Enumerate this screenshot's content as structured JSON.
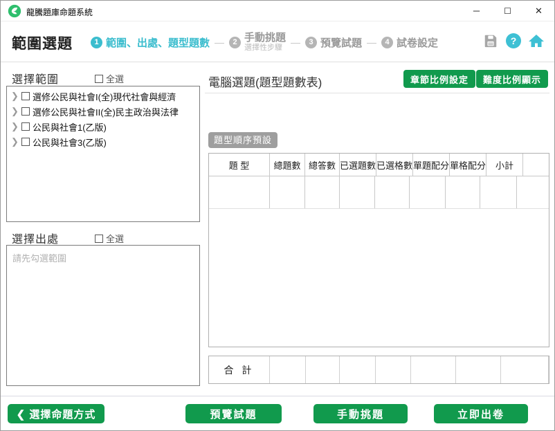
{
  "window": {
    "app_title": "龍騰題庫命題系統",
    "minimize_glyph": "─",
    "maximize_glyph": "☐",
    "close_glyph": "✕"
  },
  "header": {
    "page_title": "範圍選題",
    "step_separator": "—",
    "help_glyph": "?",
    "steps": [
      {
        "num": "1",
        "label": "範圍、出處、題型題數",
        "sublabel": ""
      },
      {
        "num": "2",
        "label": "手動挑題",
        "sublabel": "選擇性步驟"
      },
      {
        "num": "3",
        "label": "預覽試題",
        "sublabel": ""
      },
      {
        "num": "4",
        "label": "試卷設定",
        "sublabel": ""
      }
    ]
  },
  "left": {
    "range_title": "選擇範圍",
    "range_select_all": "全選",
    "tree_items": [
      "選修公民與社會I(全)現代社會與經濟",
      "選修公民與社會II(全)民主政治與法律",
      "公民與社會1(乙版)",
      "公民與社會3(乙版)"
    ],
    "chevron_glyph": "❯",
    "source_title": "選擇出處",
    "source_select_all": "全選",
    "source_placeholder": "請先勾選範圍"
  },
  "right": {
    "title": "電腦選題(題型題數表)",
    "chapter_ratio_btn": "章節比例設定",
    "difficulty_ratio_btn": "難度比例顯示",
    "type_order_badge": "題型順序預設",
    "table": {
      "headers": [
        "題  型",
        "總題數",
        "總答數",
        "已選題數",
        "已選格數",
        "單題配分",
        "單格配分",
        "小計",
        ""
      ],
      "total_label": "合 計"
    }
  },
  "footer": {
    "back_icon": "❮",
    "back_btn": "選擇命題方式",
    "preview_btn": "預覽試題",
    "manual_btn": "手動挑題",
    "generate_btn": "立即出卷"
  },
  "colors": {
    "green": "#119a4d",
    "cyan": "#3bbdce",
    "badge_gray": "#9e9e9e"
  }
}
